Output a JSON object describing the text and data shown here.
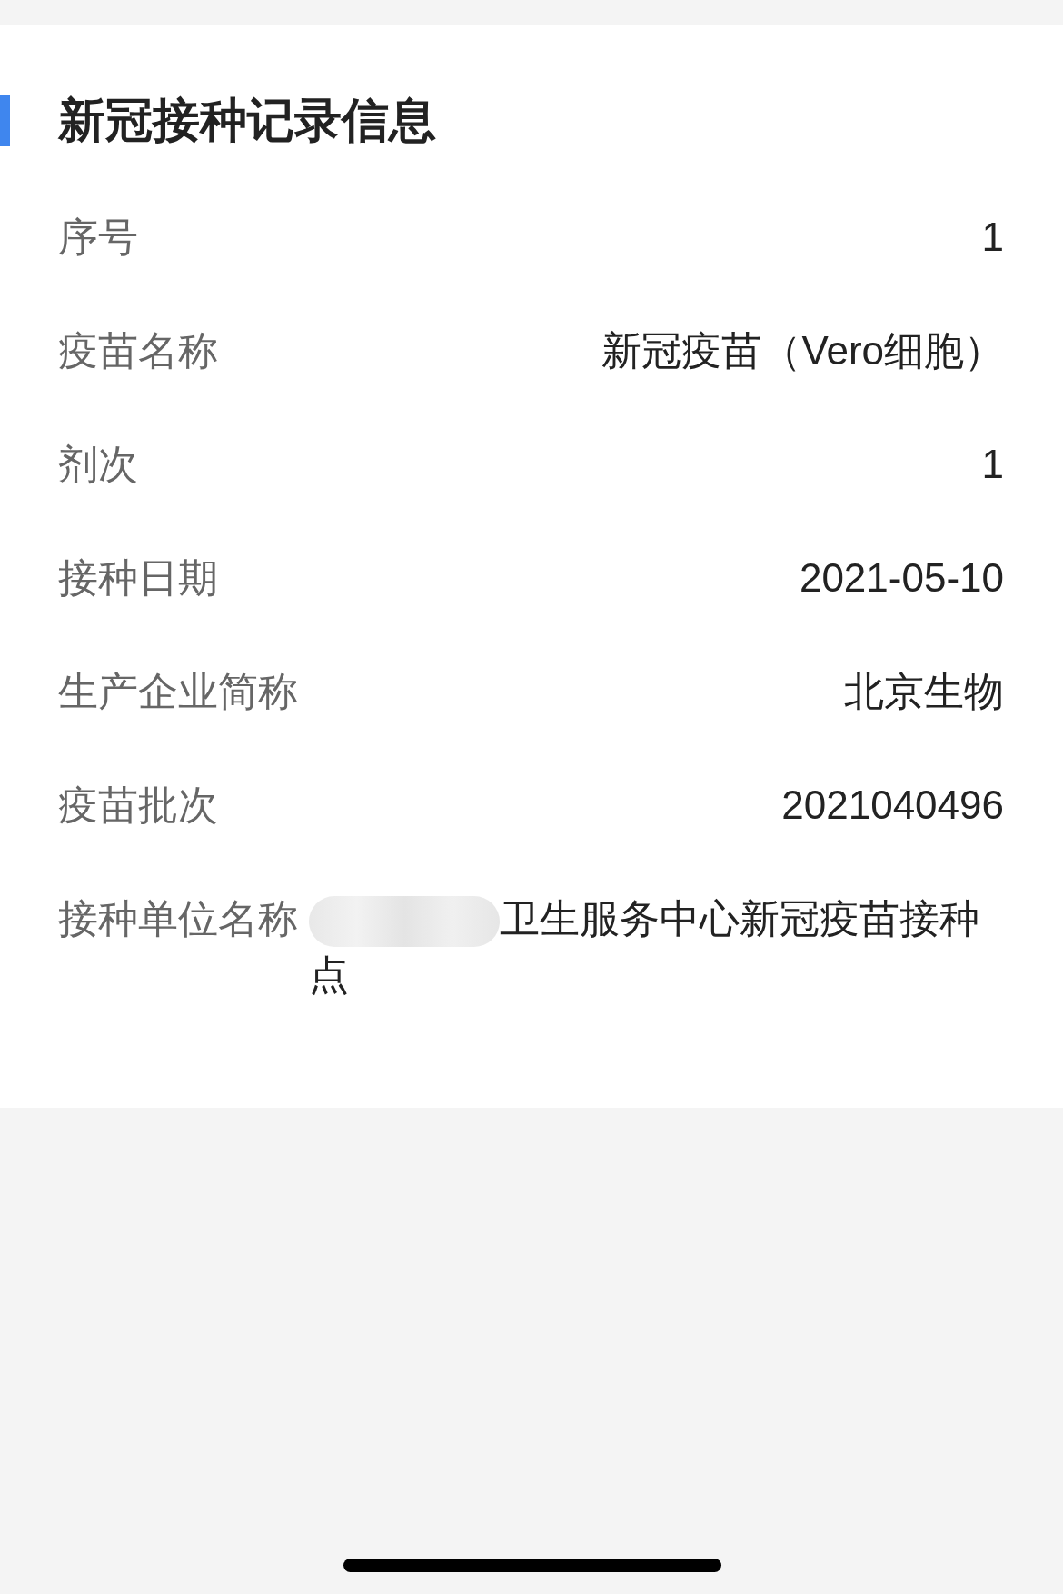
{
  "section": {
    "title": "新冠接种记录信息"
  },
  "fields": [
    {
      "label": "序号",
      "value": "1",
      "redacted": false
    },
    {
      "label": "疫苗名称",
      "value": "新冠疫苗（Vero细胞）",
      "redacted": false
    },
    {
      "label": "剂次",
      "value": "1",
      "redacted": false
    },
    {
      "label": "接种日期",
      "value": "2021-05-10",
      "redacted": false
    },
    {
      "label": "生产企业简称",
      "value": "北京生物",
      "redacted": false
    },
    {
      "label": "疫苗批次",
      "value": "2021040496",
      "redacted": false
    },
    {
      "label": "接种单位名称",
      "value": "卫生服务中心新冠疫苗接种点",
      "redacted": true
    }
  ]
}
